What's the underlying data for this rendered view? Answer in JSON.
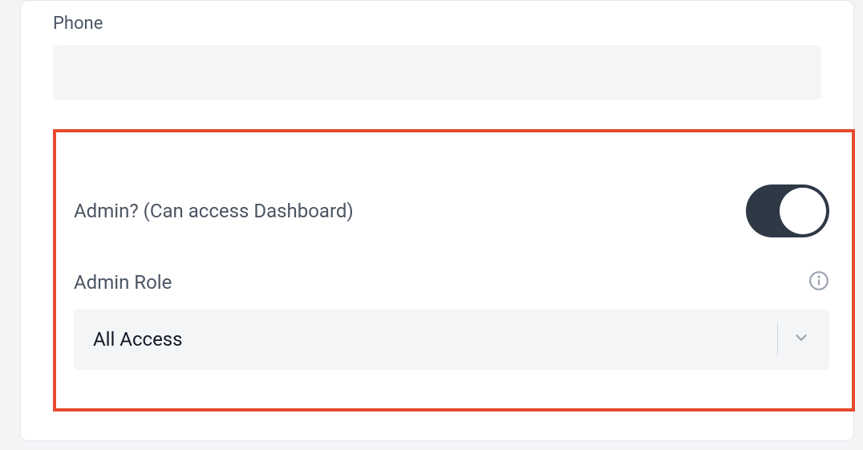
{
  "phone": {
    "label": "Phone",
    "value": ""
  },
  "admin": {
    "label": "Admin? (Can access Dashboard)",
    "enabled": true
  },
  "role": {
    "label": "Admin Role",
    "selected": "All Access"
  },
  "colors": {
    "highlight": "#e64b2d",
    "toggle_bg": "#2f3946",
    "text_muted": "#4b5563",
    "field_bg": "#f4f5f7"
  }
}
